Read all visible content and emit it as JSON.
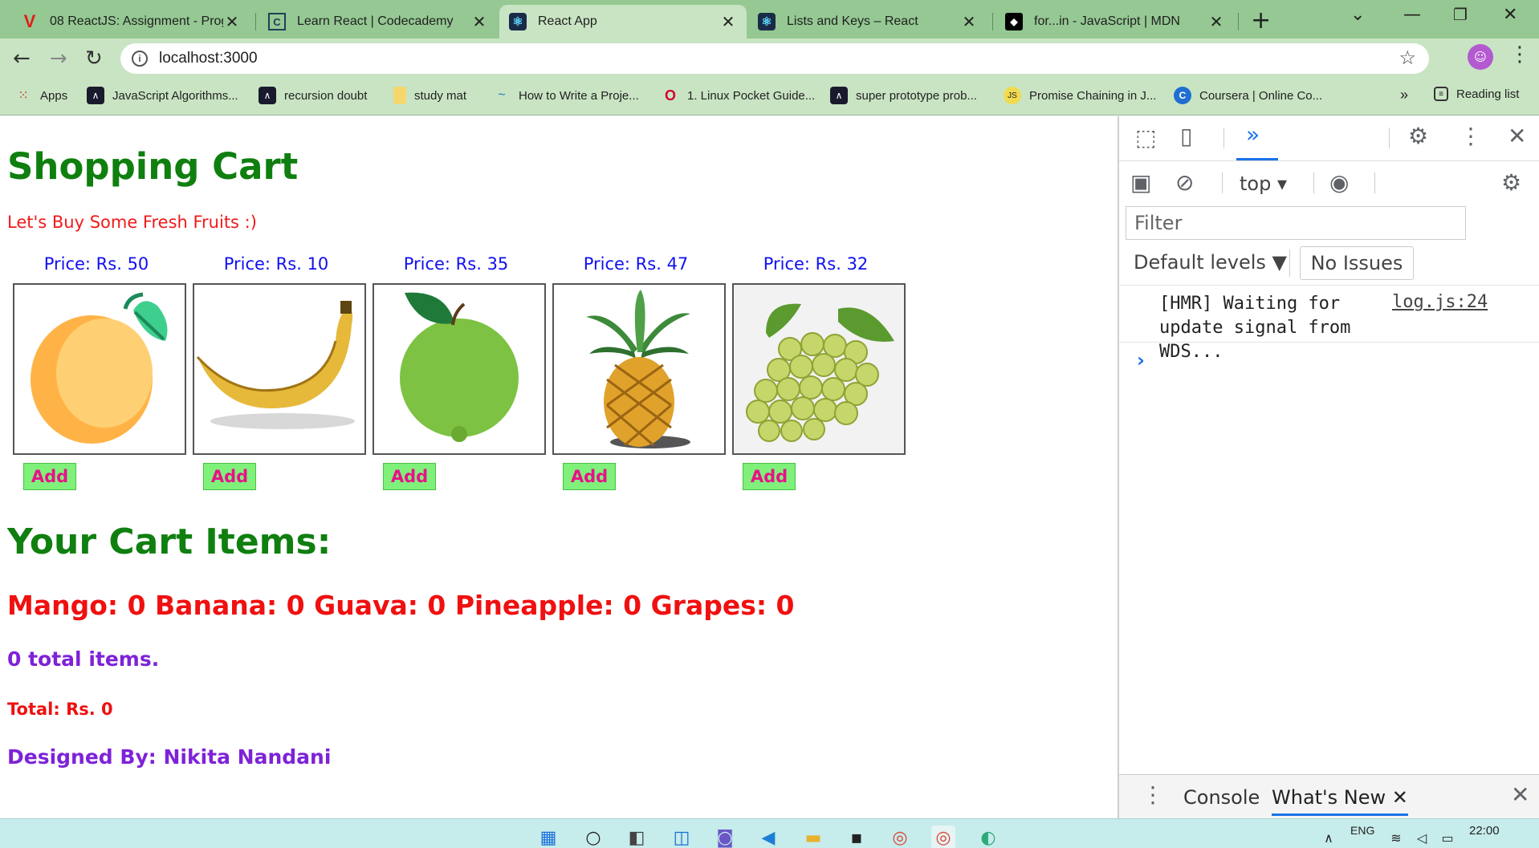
{
  "browser": {
    "tabs": [
      {
        "title": "08 ReactJS: Assignment - Progra",
        "favicon": "V",
        "favicon_color": "#e0201a"
      },
      {
        "title": "Learn React | Codecademy",
        "favicon": "C",
        "favicon_color": "#1f4056"
      },
      {
        "title": "React App",
        "favicon": "⚛",
        "favicon_color": "#1a2b4a"
      },
      {
        "title": "Lists and Keys – React",
        "favicon": "⚛",
        "favicon_color": "#1a2b4a"
      },
      {
        "title": "for...in - JavaScript | MDN",
        "favicon": "◆",
        "favicon_color": "#000000"
      }
    ],
    "url": "localhost:3000",
    "bookmarks": [
      {
        "label": "Apps"
      },
      {
        "label": "JavaScript Algorithms..."
      },
      {
        "label": "recursion doubt"
      },
      {
        "label": "study mat"
      },
      {
        "label": "How to Write a Proje..."
      },
      {
        "label": "1. Linux Pocket Guide..."
      },
      {
        "label": "super prototype prob..."
      },
      {
        "label": "Promise Chaining in J..."
      },
      {
        "label": "Coursera | Online Co..."
      },
      {
        "label": "Reading list"
      }
    ],
    "bookmark_overflow": "»"
  },
  "page": {
    "title": "Shopping Cart",
    "subtitle": "Let's Buy Some Fresh Fruits :)",
    "fruits": [
      {
        "name": "Mango",
        "price_label": "Price: Rs. 50",
        "add_label": "Add"
      },
      {
        "name": "Banana",
        "price_label": "Price: Rs. 10",
        "add_label": "Add"
      },
      {
        "name": "Guava",
        "price_label": "Price: Rs. 35",
        "add_label": "Add"
      },
      {
        "name": "Pineapple",
        "price_label": "Price: Rs. 47",
        "add_label": "Add"
      },
      {
        "name": "Grapes",
        "price_label": "Price: Rs. 32",
        "add_label": "Add"
      }
    ],
    "cart_heading": "Your Cart Items:",
    "cart_counts": "Mango: 0 Banana: 0 Guava: 0 Pineapple: 0 Grapes: 0",
    "total_items": "0 total items.",
    "total_price": "Total: Rs. 0",
    "designer": "Designed By: Nikita Nandani"
  },
  "devtools": {
    "more_tabs": "»",
    "context": "top",
    "filter_placeholder": "Filter",
    "levels": "Default levels ▼",
    "issues": "No Issues",
    "log_message": "[HMR] Waiting for update signal from WDS...",
    "log_source": "log.js:24",
    "prompt": "›",
    "drawer_tabs": [
      "Console",
      "What's New"
    ]
  },
  "taskbar": {
    "language": "ENG",
    "time": "22:00"
  },
  "colors": {
    "tab_bar": "#95c893",
    "toolbar": "#c9e4c3",
    "title_green": "#0f7f0f",
    "price_blue": "#1010f0",
    "add_bg": "#7ff07a",
    "add_text": "#e8118a",
    "purple": "#7e22d8",
    "red": "#f01010"
  }
}
